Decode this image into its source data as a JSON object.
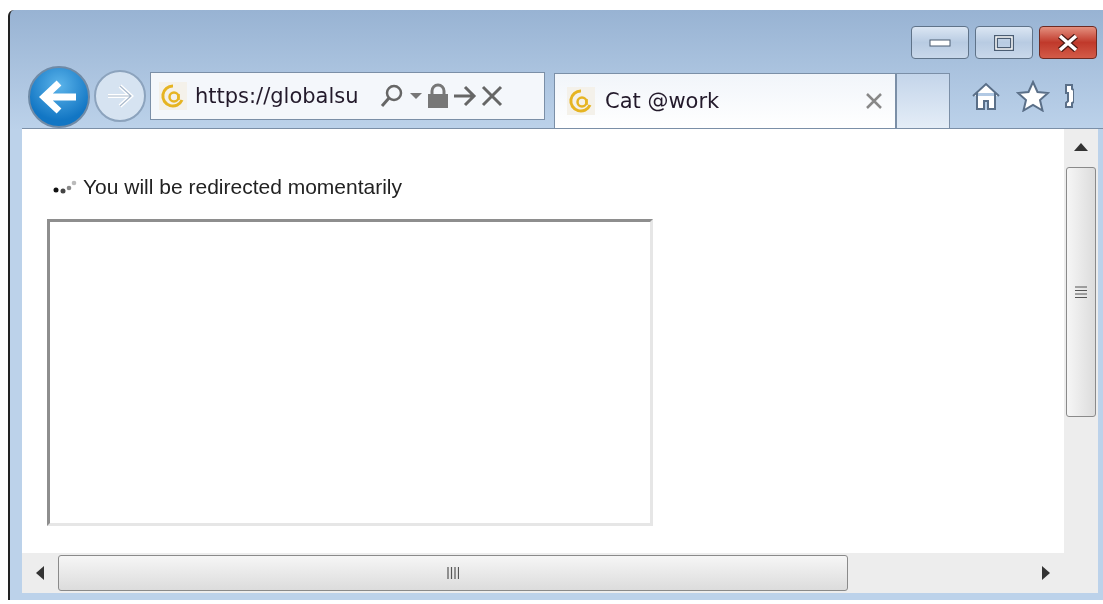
{
  "window": {
    "address_bar": {
      "value": "https://globalsu"
    },
    "tabs": [
      {
        "title": "Cat @work",
        "selected": true
      }
    ]
  },
  "page": {
    "message": "You will be redirected momentarily"
  }
}
